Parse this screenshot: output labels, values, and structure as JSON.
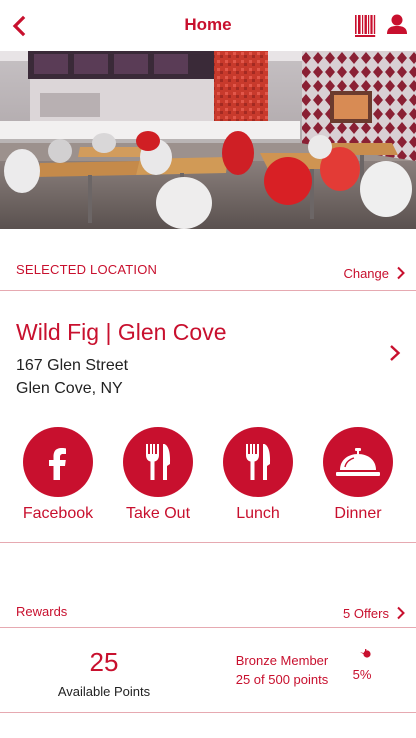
{
  "header": {
    "title": "Home",
    "back_icon": "chevron-left-icon",
    "barcode_icon": "barcode-icon",
    "profile_icon": "user-icon"
  },
  "location": {
    "section_label": "SELECTED LOCATION",
    "change_label": "Change",
    "name": "Wild Fig | Glen Cove",
    "address_line1": "167 Glen Street",
    "address_line2": "Glen Cove, NY"
  },
  "actions": [
    {
      "label": "Facebook",
      "icon": "facebook-icon"
    },
    {
      "label": "Take Out",
      "icon": "fork-knife-icon"
    },
    {
      "label": "Lunch",
      "icon": "fork-knife-icon"
    },
    {
      "label": "Dinner",
      "icon": "service-bell-icon"
    }
  ],
  "rewards": {
    "section_label": "Rewards",
    "offers_label": "5 Offers",
    "points": "25",
    "points_label": "Available Points",
    "tier": "Bronze Member",
    "progress_text": "25 of 500 points",
    "percent_text": "5%",
    "progress_fraction": 0.05
  },
  "colors": {
    "accent": "#c8102e",
    "divider": "#e6a9b1"
  }
}
